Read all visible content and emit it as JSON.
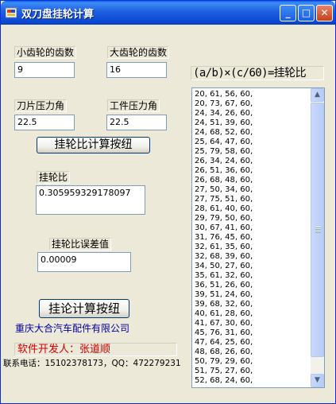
{
  "window": {
    "title": "双刀盘挂轮计算",
    "min_icon": "minimize-icon",
    "max_icon": "maximize-icon",
    "close_icon": "close-icon",
    "close_glyph": "✕",
    "min_glyph": "_",
    "max_glyph": "□"
  },
  "small_gear": {
    "label": "小齿轮的齿数",
    "value": "9"
  },
  "large_gear": {
    "label": "大齿轮的齿数",
    "value": "16"
  },
  "blade_angle": {
    "label": "刀片压力角",
    "value": "22.5"
  },
  "work_angle": {
    "label": "工件压力角",
    "value": "22.5"
  },
  "calc_ratio_button": "挂轮比计算按纽",
  "ratio": {
    "label": "挂轮比",
    "value": "0.305959329178097"
  },
  "ratio_error": {
    "label": "挂轮比误差值",
    "value": "0.00009"
  },
  "calc_gear_button": "挂论计算按纽",
  "formula": "(a/b)×(c/60)=挂轮比",
  "results": [
    "20, 61, 56, 60,",
    "20, 73, 67, 60,",
    "24, 34, 26, 60,",
    "24, 51, 39, 60,",
    "24, 68, 52, 60,",
    "25, 64, 47, 60,",
    "25, 79, 58, 60,",
    "26, 34, 24, 60,",
    "26, 51, 36, 60,",
    "26, 68, 48, 60,",
    "27, 50, 34, 60,",
    "27, 75, 51, 60,",
    "28, 61, 40, 60,",
    "29, 79, 50, 60,",
    "30, 67, 41, 60,",
    "31, 76, 45, 60,",
    "32, 61, 35, 60,",
    "32, 68, 39, 60,",
    "34, 50, 27, 60,",
    "35, 61, 32, 60,",
    "36, 51, 26, 60,",
    "39, 51, 24, 60,",
    "39, 68, 32, 60,",
    "40, 61, 28, 60,",
    "41, 67, 30, 60,",
    "45, 76, 31, 60,",
    "47, 64, 25, 60,",
    "48, 68, 26, 60,",
    "50, 79, 29, 60,",
    "51, 75, 27, 60,",
    "52, 68, 24, 60,"
  ],
  "company": "重庆大合汽车配件有限公司",
  "developer": "软件开发人：张道顺",
  "contact": "联系电话：15102378173，QQ：472279231",
  "scroll_up_glyph": "▲",
  "scroll_down_glyph": "▼"
}
